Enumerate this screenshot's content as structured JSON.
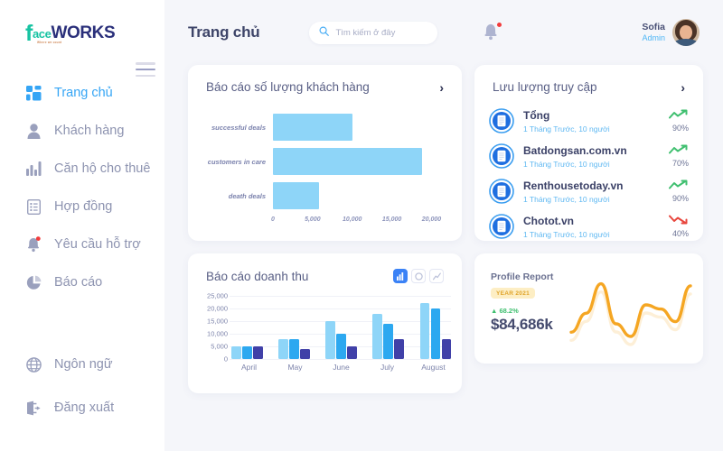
{
  "brand": {
    "logo_f": "f",
    "logo_ace": "ace",
    "logo_works": "WORKS",
    "logo_tagline": "Where we count"
  },
  "sidebar": {
    "items": [
      {
        "label": "Trang chủ",
        "icon": "grid-icon",
        "active": true
      },
      {
        "label": "Khách hàng",
        "icon": "user-icon",
        "active": false
      },
      {
        "label": "Căn hộ cho thuê",
        "icon": "bar-chart-icon",
        "active": false
      },
      {
        "label": "Hợp đồng",
        "icon": "document-icon",
        "active": false
      },
      {
        "label": "Yêu cầu hỗ trợ",
        "icon": "bell-icon",
        "active": false
      },
      {
        "label": "Báo cáo",
        "icon": "pie-chart-icon",
        "active": false
      }
    ],
    "bottom_items": [
      {
        "label": "Ngôn ngữ",
        "icon": "globe-icon"
      },
      {
        "label": "Đăng xuất",
        "icon": "logout-icon"
      }
    ]
  },
  "header": {
    "title": "Trang chủ",
    "search_placeholder": "Tìm kiếm ở đây",
    "search_value": "",
    "search_icon": "search-icon",
    "bell_icon": "bell-icon",
    "has_notification": true,
    "user_name": "Sofia",
    "user_role": "Admin"
  },
  "customer_report": {
    "title": "Báo cáo số lượng khách hàng",
    "chevron": "›"
  },
  "revenue_report": {
    "title": "Báo cáo doanh thu",
    "toggles": [
      {
        "icon": "bar-chart-icon",
        "active": true
      },
      {
        "icon": "pie-chart-icon",
        "active": false
      },
      {
        "icon": "line-chart-icon",
        "active": false
      }
    ]
  },
  "traffic": {
    "title": "Lưu lượng truy cập",
    "chevron": "›",
    "items": [
      {
        "name": "Tổng",
        "sub": "1 Tháng Trước, 10 người",
        "percent": "90%",
        "trend": "up"
      },
      {
        "name": "Batdongsan.com.vn",
        "sub": "1 Tháng Trước, 10 người",
        "percent": "70%",
        "trend": "up"
      },
      {
        "name": "Renthousetoday.vn",
        "sub": "1 Tháng Trước, 10 người",
        "percent": "90%",
        "trend": "up"
      },
      {
        "name": "Chotot.vn",
        "sub": "1 Tháng Trước, 10 người",
        "percent": "40%",
        "trend": "down"
      }
    ]
  },
  "profile_report": {
    "title": "Profile Report",
    "badge": "YEAR 2021",
    "change": "▲ 68.2%",
    "value": "$84,686k",
    "line_color": "#f5a623"
  },
  "colors": {
    "accent_blue": "#35a5f5",
    "light_blue": "#8ed5f8",
    "bright_blue": "#2ca8f0",
    "navy": "#4040a8",
    "sidebar_text": "#8d93b0",
    "bg": "#f5f6fa",
    "orange": "#f5a623",
    "green": "#3fbf6f",
    "red": "#e8453c"
  },
  "chart_data": [
    {
      "type": "bar",
      "orientation": "horizontal",
      "title": "Báo cáo số lượng khách hàng",
      "categories": [
        "successful deals",
        "customers in care",
        "death deals"
      ],
      "values": [
        10000,
        18800,
        5800
      ],
      "xlabel": "",
      "ylabel": "",
      "xlim": [
        0,
        22000
      ],
      "xticks": [
        0,
        5000,
        10000,
        15000,
        20000
      ],
      "xtick_labels": [
        "0",
        "5,000",
        "10,000",
        "15,000",
        "20,000"
      ],
      "bar_color": "#8ed5f8",
      "grid": false,
      "legend": false
    },
    {
      "type": "bar",
      "orientation": "vertical",
      "title": "Báo cáo doanh thu",
      "categories": [
        "April",
        "May",
        "June",
        "July",
        "August"
      ],
      "series": [
        {
          "name": "series-1",
          "color": "#8ed5f8",
          "values": [
            5000,
            8000,
            15000,
            18000,
            22000
          ]
        },
        {
          "name": "series-2",
          "color": "#2ca8f0",
          "values": [
            5000,
            8000,
            10000,
            14000,
            20000
          ]
        },
        {
          "name": "series-3",
          "color": "#4040a8",
          "values": [
            5000,
            4000,
            5000,
            8000,
            8000
          ]
        }
      ],
      "xlabel": "",
      "ylabel": "",
      "ylim": [
        0,
        25000
      ],
      "yticks": [
        0,
        5000,
        10000,
        15000,
        20000,
        25000
      ],
      "ytick_labels": [
        "0",
        "5,000",
        "10,000",
        "15,000",
        "20,000",
        "25,000"
      ],
      "grid": true,
      "legend": false
    },
    {
      "type": "line",
      "title": "Profile Report",
      "x": [
        0,
        1,
        2,
        3,
        4,
        5,
        6,
        7,
        8
      ],
      "values": [
        12,
        30,
        58,
        20,
        8,
        38,
        34,
        22,
        56
      ],
      "line_color": "#f5a623",
      "grid": false,
      "legend": false,
      "axis_visible": false
    }
  ]
}
